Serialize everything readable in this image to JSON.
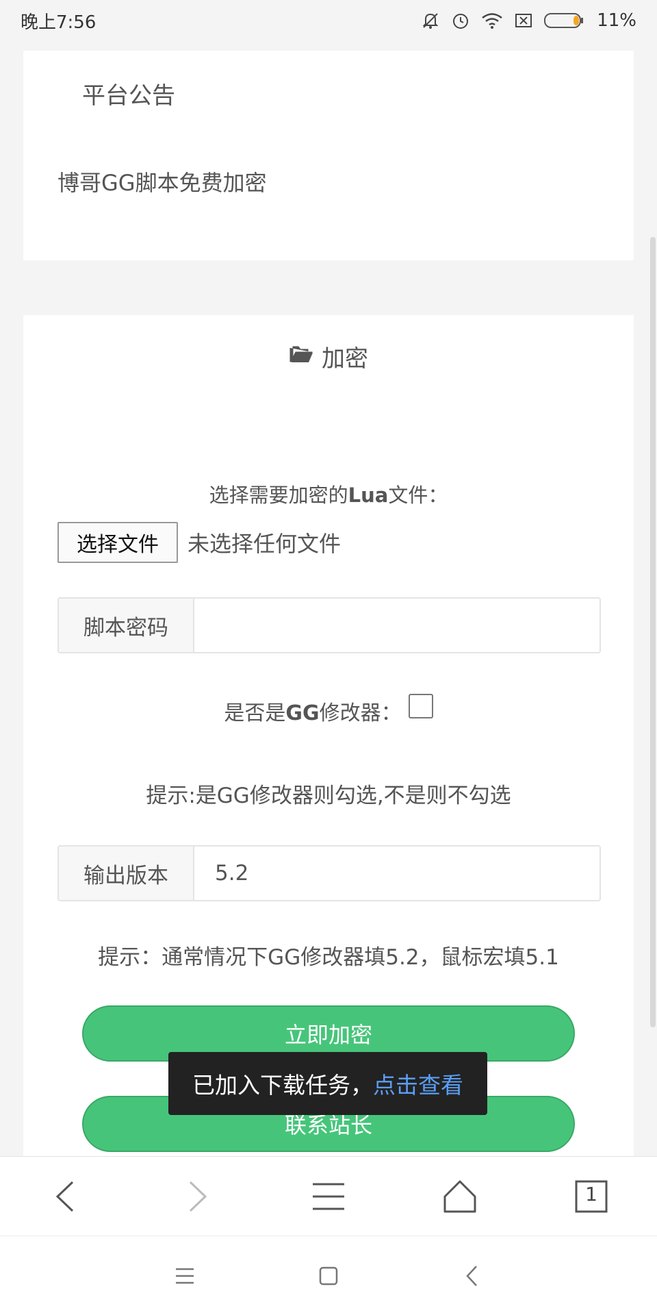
{
  "status_bar": {
    "time": "晚上7:56",
    "battery_percent": "11%",
    "icons": [
      "mute-bell-icon",
      "alarm-icon",
      "wifi-icon",
      "sim-off-icon",
      "battery-icon"
    ]
  },
  "announcement": {
    "title": "平台公告",
    "body": "博哥GG脚本免费加密"
  },
  "encrypt": {
    "title": "加密",
    "title_icon": "folder-open-icon",
    "file_label_prefix": "选择需要加密的",
    "file_label_bold": "Lua",
    "file_label_suffix": "文件：",
    "file_button": "选择文件",
    "file_status": "未选择任何文件",
    "password_label": "脚本密码",
    "password_value": "",
    "gg_label_prefix": "是否是",
    "gg_label_bold": "GG",
    "gg_label_suffix": "修改器：",
    "gg_checked": false,
    "hint_gg": "提示:是GG修改器则勾选,不是则不勾选",
    "version_label": "输出版本",
    "version_value": "5.2",
    "hint_version": "提示：通常情况下GG修改器填5.2，鼠标宏填5.1",
    "encrypt_button": "立即加密",
    "contact_button": "联系站长"
  },
  "toast": {
    "text": "已加入下载任务，",
    "link": "点击查看"
  },
  "browser_bar": {
    "icons": [
      "back-icon",
      "forward-icon",
      "menu-icon",
      "home-icon",
      "tabs-icon"
    ],
    "tab_count": "1"
  },
  "system_nav": {
    "icons": [
      "recent-apps-icon",
      "home-square-icon",
      "system-back-icon"
    ]
  },
  "colors": {
    "accent_green": "#46c57a",
    "toast_link": "#5a9ef5",
    "battery_low": "#f5a623"
  }
}
